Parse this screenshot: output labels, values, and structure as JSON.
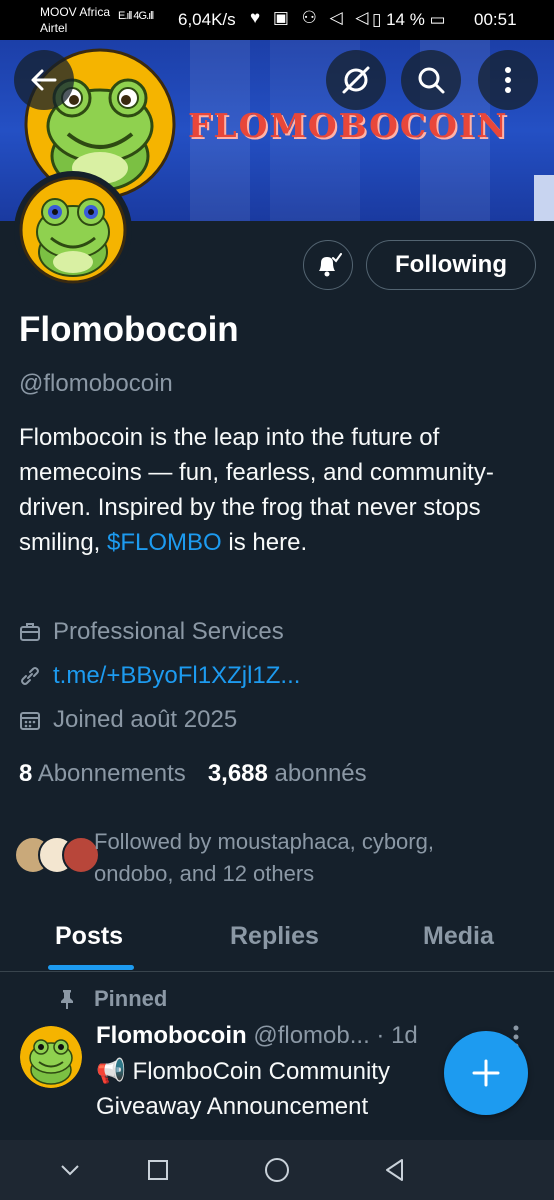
{
  "status_bar": {
    "carrier_line1": "MOOV Africa",
    "carrier_line2": "Airtel",
    "signal": "E.ıll 4G.ıll",
    "speed": "6,04K/s",
    "icons": "♥ ▣ ⚇ ◁ ◁",
    "battery": "14 %",
    "time": "00:51"
  },
  "banner": {
    "title": "FLOMOBOCOIN"
  },
  "actions": {
    "following_label": "Following"
  },
  "profile": {
    "name": "Flomobocoin",
    "handle": "@flomobocoin",
    "bio_text": "Flombocoin is the leap into the future of memecoins — fun, fearless, and community-driven. Inspired by the frog that never stops smiling, ",
    "bio_hashtag": "$FLOMBO",
    "bio_end": " is here.",
    "category": "Professional Services",
    "link": "t.me/+BByoFl1XZjl1Z...",
    "joined": "Joined août 2025",
    "following_count": "8",
    "following_label": "Abonnements",
    "followers_count": "3,688",
    "followers_label": "abonnés",
    "followed_by_line1": "Followed by moustaphaca, cyborg,",
    "followed_by_line2": "ondobo, and 12 others"
  },
  "tabs": [
    {
      "label": "Posts",
      "active": true
    },
    {
      "label": "Replies",
      "active": false
    },
    {
      "label": "Media",
      "active": false
    }
  ],
  "pinned_post": {
    "pinned_label": "Pinned",
    "name": "Flomobocoin",
    "handle": "@flomob...",
    "time": "· 1d",
    "text": "📢 FlomboCoin Community Giveaway Announcement"
  },
  "colors": {
    "background": "#15202b",
    "accent": "#1d9bf0",
    "muted": "#8b98a5",
    "banner": "#2450c4",
    "banner_title": "#e8473a"
  }
}
